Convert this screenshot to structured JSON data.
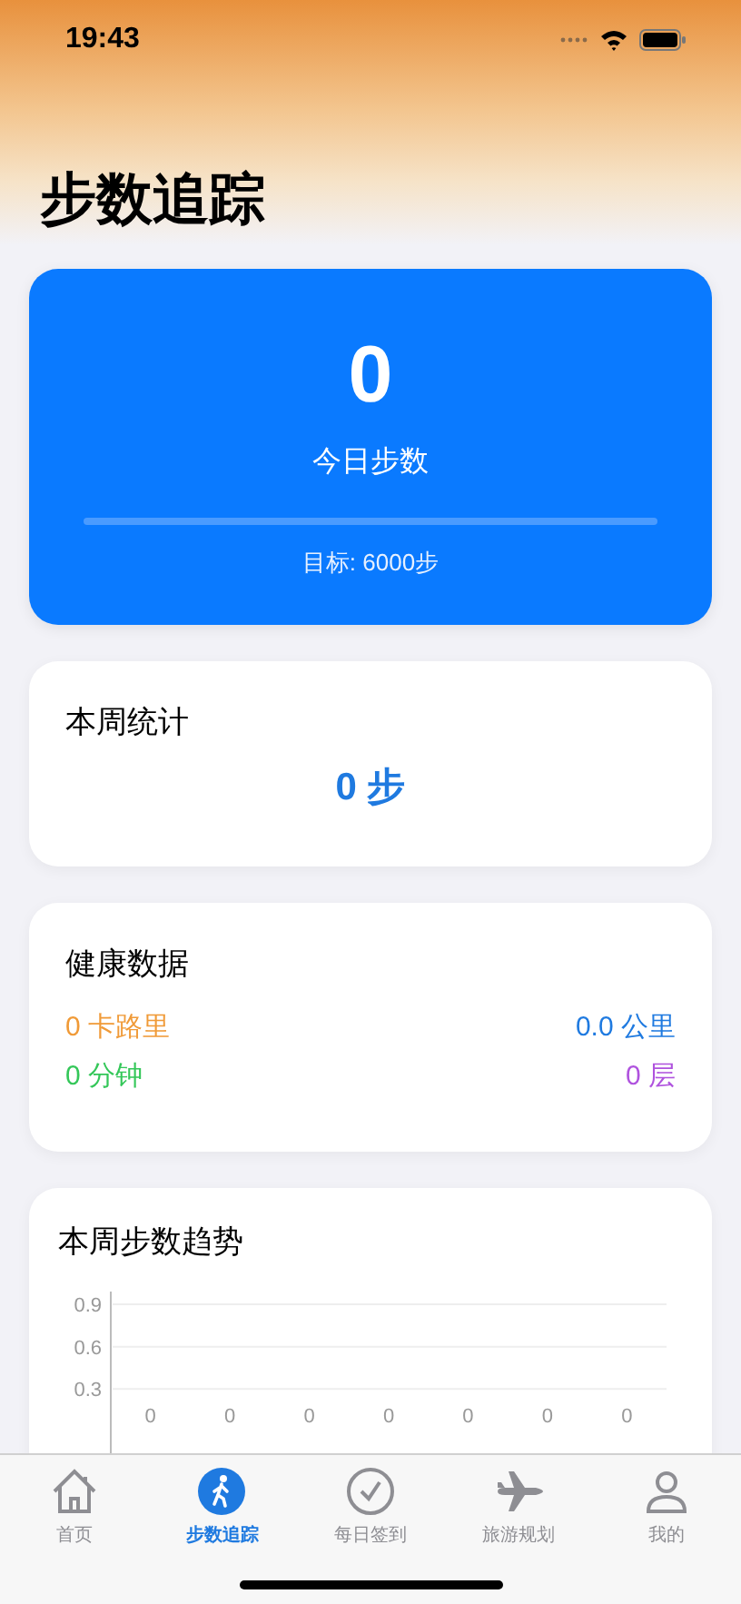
{
  "status_bar": {
    "time": "19:43"
  },
  "title": "步数追踪",
  "today": {
    "steps": "0",
    "label": "今日步数",
    "level": 0,
    "goal": "目标: 6000步"
  },
  "week": {
    "title": "本周统计",
    "steps": "0 步"
  },
  "health": {
    "title": "健康数据",
    "items": [
      {
        "text": "0 卡路里",
        "color": "#f09a37"
      },
      {
        "text": "0.0 公里",
        "color": "#1f7ae0"
      },
      {
        "text": "0 分钟",
        "color": "#34c759"
      },
      {
        "text": "0 层",
        "color": "#af52de"
      }
    ]
  },
  "trend": {
    "title": "本周步数趋势",
    "chart_data": {
      "type": "bar",
      "values": [
        0,
        0,
        0,
        0,
        0,
        0,
        0
      ],
      "ylim": [
        0,
        0.9
      ],
      "yticks": [
        0.3,
        0.6,
        0.9
      ],
      "data_labels": true
    }
  },
  "tabs": [
    {
      "label": "首页",
      "kind": "home",
      "selected": false
    },
    {
      "label": "步数追踪",
      "kind": "walk",
      "selected": true
    },
    {
      "label": "每日签到",
      "kind": "check",
      "selected": false
    },
    {
      "label": "旅游规划",
      "kind": "plane",
      "selected": false
    },
    {
      "label": "我的",
      "kind": "person",
      "selected": false
    }
  ]
}
